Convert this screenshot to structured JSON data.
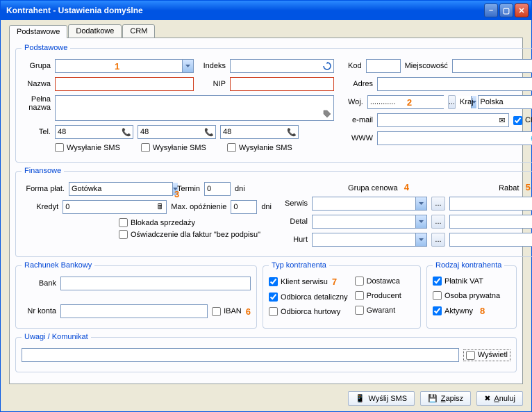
{
  "window": {
    "title": "Kontrahent - Ustawienia domyślne"
  },
  "tabs": {
    "t1": "Podstawowe",
    "t2": "Dodatkowe",
    "t3": "CRM"
  },
  "podstawowe": {
    "legend": "Podstawowe",
    "grupa_label": "Grupa",
    "grupa": "",
    "indeks_label": "Indeks",
    "indeks": "",
    "kod_label": "Kod",
    "kod": "",
    "miejscowosc_label": "Miejscowość",
    "miejscowosc": "",
    "nazwa_label": "Nazwa",
    "nazwa": "",
    "nip_label": "NIP",
    "nip": "",
    "adres_label": "Adres",
    "adres": "",
    "pelna_label": "Pełna\nnazwa",
    "pelna": "",
    "woj_label": "Woj.",
    "woj": "............",
    "kraj_label": "Kraj",
    "kraj": "Polska",
    "email_label": "e-mail",
    "email": "",
    "crm_label": "CRM",
    "www_label": "WWW",
    "www": "",
    "tel_label": "Tel.",
    "tel1": "48",
    "tel2": "48",
    "tel3": "48",
    "sms_label": "Wysyłanie SMS"
  },
  "markers": {
    "m1": "1",
    "m2": "2",
    "m3": "3",
    "m4": "4",
    "m5": "5",
    "m6": "6",
    "m7": "7",
    "m8": "8"
  },
  "finansowe": {
    "legend": "Finansowe",
    "forma_label": "Forma płat.",
    "forma": "Gotówka",
    "termin_label": "Termin",
    "termin": "0",
    "dni": "dni",
    "kredyt_label": "Kredyt",
    "kredyt": "0",
    "maxop_label": "Max. opóźnienie",
    "maxop": "0",
    "blokada_label": "Blokada sprzedaży",
    "oswiadczenie_label": "Oświadczenie dla faktur \"bez podpisu\"",
    "grupacen_label": "Grupa cenowa",
    "rabat_label": "Rabat",
    "serwis_label": "Serwis",
    "detal_label": "Detal",
    "hurt_label": "Hurt"
  },
  "bank": {
    "legend": "Rachunek Bankowy",
    "bank_label": "Bank",
    "nr_label": "Nr konta",
    "iban_label": "IBAN"
  },
  "typ": {
    "legend": "Typ kontrahenta",
    "klient": "Klient serwisu",
    "odbiorca_d": "Odbiorca detaliczny",
    "odbiorca_h": "Odbiorca hurtowy",
    "dostawca": "Dostawca",
    "producent": "Producent",
    "gwarant": "Gwarant"
  },
  "rodzaj": {
    "legend": "Rodzaj kontrahenta",
    "platnik": "Płatnik VAT",
    "osoba": "Osoba prywatna",
    "aktywny": "Aktywny"
  },
  "uwagi": {
    "legend": "Uwagi / Komunikat",
    "wyswietl": "Wyświetl"
  },
  "buttons": {
    "sms": "Wyślij SMS",
    "zapisz": "Zapisz",
    "anuluj": "Anuluj"
  },
  "ellipsis": "..."
}
